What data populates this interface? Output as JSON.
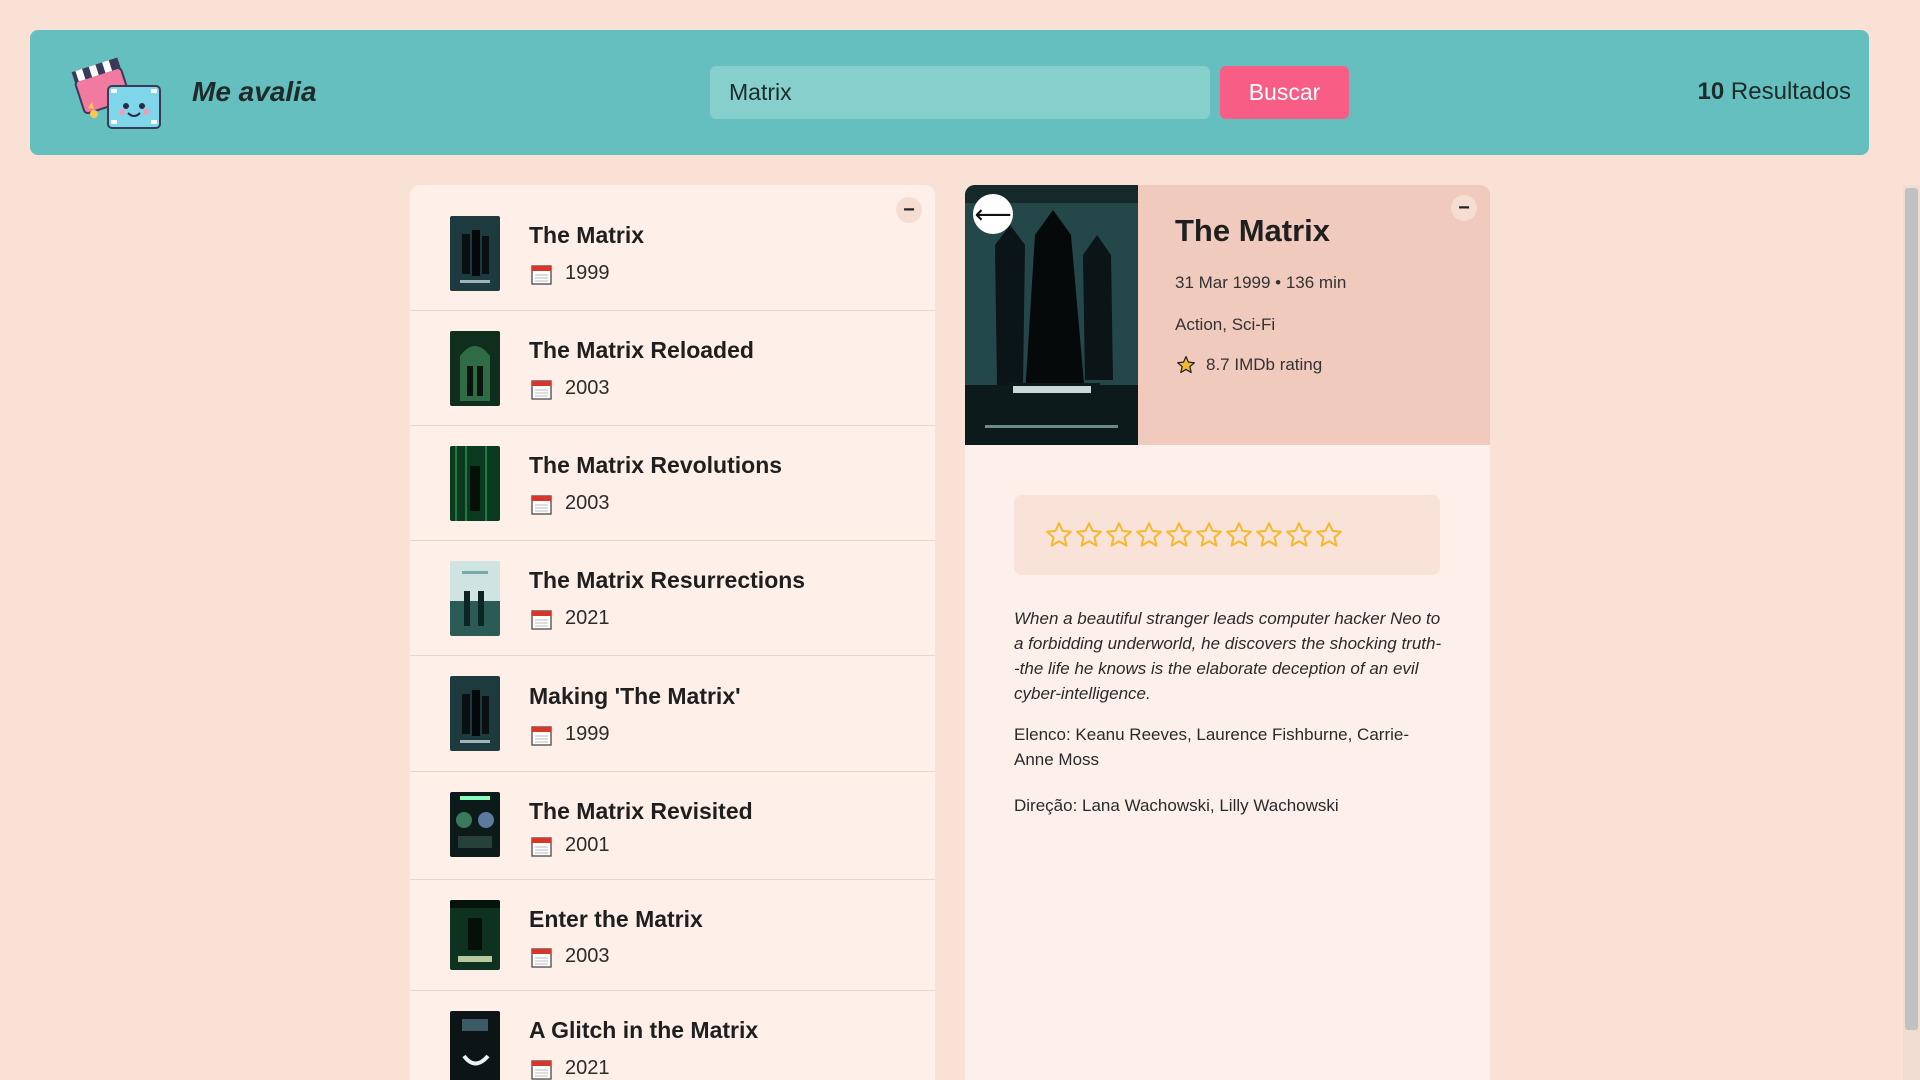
{
  "header": {
    "brand": "Me avalia",
    "search_value": "Matrix",
    "search_button": "Buscar",
    "results_count": "10",
    "results_label": " Resultados"
  },
  "list": {
    "collapse_symbol": "−",
    "items": [
      {
        "title": "The Matrix",
        "year": "1999"
      },
      {
        "title": "The Matrix Reloaded",
        "year": "2003"
      },
      {
        "title": "The Matrix Revolutions",
        "year": "2003"
      },
      {
        "title": "The Matrix Resurrections",
        "year": "2021"
      },
      {
        "title": "Making 'The Matrix'",
        "year": "1999"
      },
      {
        "title": "The Matrix Revisited",
        "year": "2001"
      },
      {
        "title": "Enter the Matrix",
        "year": "2003"
      },
      {
        "title": "A Glitch in the Matrix",
        "year": "2021"
      }
    ]
  },
  "detail": {
    "collapse_symbol": "−",
    "back_symbol": "⟵",
    "title": "The Matrix",
    "date_runtime": "31 Mar 1999 • 136 min",
    "genres": "Action, Sci-Fi",
    "rating": "8.7 IMDb rating",
    "user_rating_max": 10,
    "user_rating_value": 0,
    "plot": "When a beautiful stranger leads computer hacker Neo to a forbidding underworld, he discovers the shocking truth--the life he knows is the elaborate deception of an evil cyber-intelligence.",
    "cast": "Elenco: Keanu Reeves, Laurence Fishburne, Carrie-Anne Moss",
    "director": "Direção: Lana Wachowski, Lilly Wachowski"
  },
  "colors": {
    "page_bg": "#fae1d6",
    "header_bg": "#64bfbe",
    "accent": "#f85d86",
    "star": "#f5b82e"
  },
  "icons": {
    "logo": "clapperboard-film-logo",
    "calendar": "calendar-icon",
    "star": "star-icon"
  }
}
